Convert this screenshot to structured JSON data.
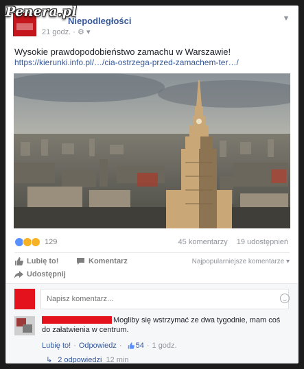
{
  "watermark": "Penera.pl",
  "post": {
    "page_name": "Niepodległości",
    "time": "21 godz.",
    "privacy_icon": "globe-icon",
    "text": "Wysokie prawdopodobieństwo zamachu w Warszawie!",
    "link": "https://kierunki.info.pl/…/cia-ostrzega-przed-zamachem-ter…/"
  },
  "stats": {
    "reaction_count": "129",
    "comments": "45 komentarzy",
    "shares": "19 udostępnień",
    "reaction_icons": [
      "like-icon",
      "wow-icon",
      "sad-icon"
    ]
  },
  "actions": {
    "like": "Lubię to!",
    "comment": "Komentarz",
    "share": "Udostępnij",
    "sort": "Najpopularniejsze komentarze"
  },
  "composer": {
    "placeholder": "Napisz komentarz..."
  },
  "comment": {
    "text": "Mogliby się wstrzymać ze dwa tygodnie, mam coś do załatwienia w centrum.",
    "like": "Lubię to!",
    "reply": "Odpowiedz",
    "likes": "54",
    "time": "1 godz.",
    "replies": "2 odpowiedzi",
    "replies_time": "12 min"
  },
  "colors": {
    "link": "#365899",
    "meta": "#90949c",
    "redaction": "#e3121c"
  }
}
